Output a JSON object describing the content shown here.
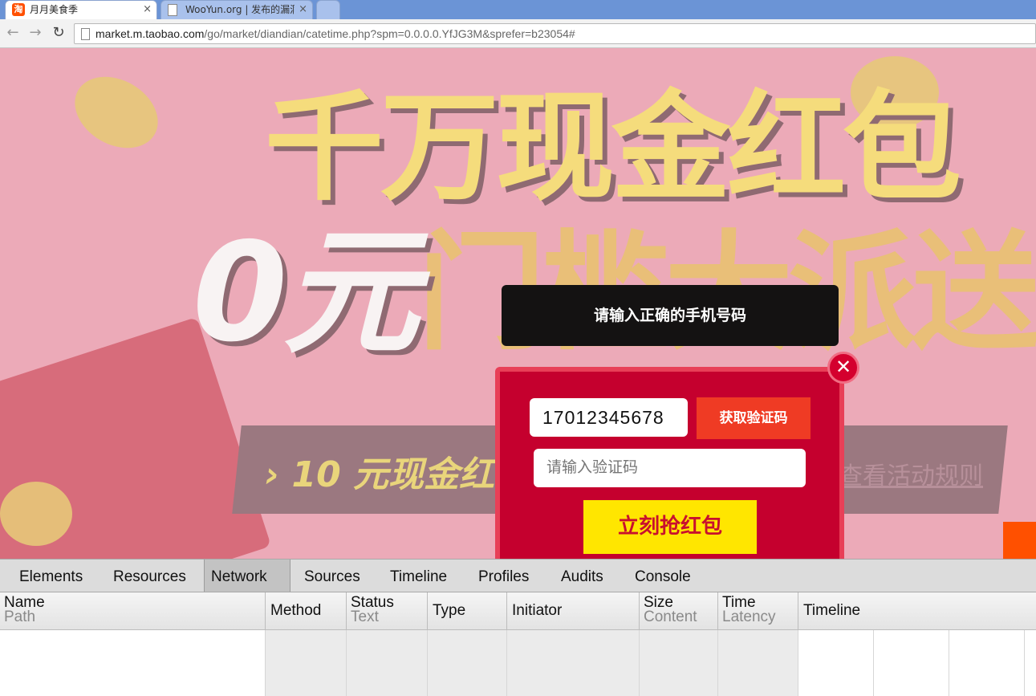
{
  "browser": {
    "tabs": [
      {
        "title": "月月美食季",
        "favicon": "taobao-favicon",
        "active": true
      },
      {
        "title": "WooYun.org | 发布的漏洞",
        "favicon": "page-icon",
        "active": false
      }
    ],
    "tab_close_glyph": "×",
    "taobao_favicon_glyph": "淘",
    "url_host": "market.m.taobao.com",
    "url_path": "/go/market/diandian/catetime.php?spm=0.0.0.0.YfJG3M&sprefer=b23054#"
  },
  "page": {
    "headline": "千万现金红包",
    "zero_yuan": "0元",
    "sub_headline": "门槛大派送",
    "banner_text": "10 元现金红",
    "banner_arrow": "›",
    "rules_link": "查看活动规则"
  },
  "toast": {
    "message": "请输入正确的手机号码"
  },
  "modal": {
    "phone_value": "17012345678",
    "get_code_label": "获取验证码",
    "code_placeholder": "请输入验证码",
    "grab_label": "立刻抢红包",
    "close_glyph": "✕"
  },
  "devtools": {
    "tabs": [
      "Elements",
      "Resources",
      "Network",
      "Sources",
      "Timeline",
      "Profiles",
      "Audits",
      "Console"
    ],
    "selected_tab": "Network",
    "columns": [
      {
        "main": "Name",
        "sub": "Path"
      },
      {
        "main": "Method",
        "sub": ""
      },
      {
        "main": "Status",
        "sub": "Text"
      },
      {
        "main": "Type",
        "sub": ""
      },
      {
        "main": "Initiator",
        "sub": ""
      },
      {
        "main": "Size",
        "sub": "Content"
      },
      {
        "main": "Time",
        "sub": "Latency"
      },
      {
        "main": "Timeline",
        "sub": ""
      }
    ]
  },
  "colors": {
    "modal_red": "#c5002e",
    "get_code_orange": "#ef3b24",
    "grab_yellow": "#ffe600",
    "toast_black": "#141212",
    "page_bg_pink": "#ecaab8"
  }
}
